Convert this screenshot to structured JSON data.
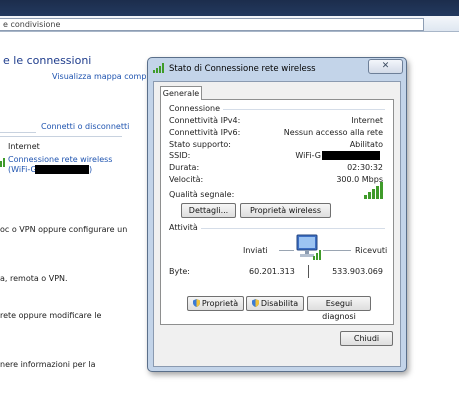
{
  "background_window": {
    "address_text": "e condivisione",
    "heading": "e le connessioni",
    "view_map_link": "Visualizza mappa completa",
    "connect_link": "Connetti o disconnetti",
    "network_type": "Internet",
    "connection_link_line1": "Connessione rete wireless",
    "connection_link_line2": "(WiFi-G",
    "connection_link_line2_end": ")",
    "text_lines": [
      "oc o VPN oppure configurare un",
      "a, remota o VPN.",
      "rete oppure modificare le",
      "nere informazioni per la"
    ]
  },
  "dialog": {
    "title": "Stato di Connessione rete wireless",
    "close_glyph": "✕",
    "tab_label": "Generale",
    "connection_group": "Connessione",
    "rows": [
      {
        "label": "Connettività IPv4:",
        "value": "Internet"
      },
      {
        "label": "Connettività IPv6:",
        "value": "Nessun accesso alla rete"
      },
      {
        "label": "Stato supporto:",
        "value": "Abilitato"
      },
      {
        "label": "SSID:",
        "value": "WiFi-G"
      },
      {
        "label": "Durata:",
        "value": "02:30:32"
      },
      {
        "label": "Velocità:",
        "value": "300.0 Mbps"
      }
    ],
    "signal_label": "Qualità segnale:",
    "signal_bars": 5,
    "details_button": "Dettagli...",
    "wireless_props_button": "Proprietà wireless",
    "activity_group": "Attività",
    "sent_label": "Inviati",
    "received_label": "Ricevuti",
    "bytes_label": "Byte:",
    "bytes_sent": "60.201.313",
    "bytes_received": "533.903.069",
    "properties_button": "Proprietà",
    "disable_button": "Disabilita",
    "diagnose_button": "Esegui diagnosi",
    "close_button": "Chiudi"
  },
  "colors": {
    "link": "#1f54b0",
    "signal_green": "#3f9b2a",
    "dialog_frame": "#c3d4e9"
  }
}
